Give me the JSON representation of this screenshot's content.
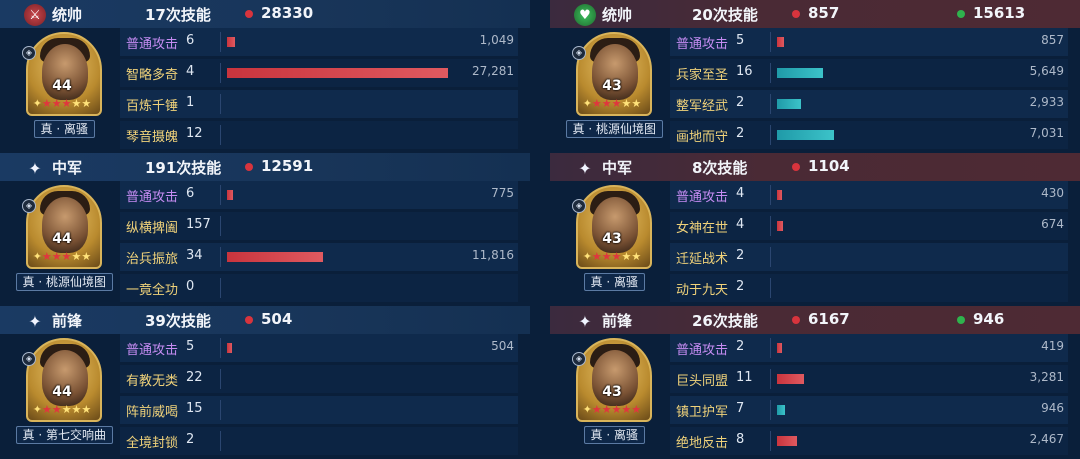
{
  "left": {
    "sections": [
      {
        "role": "统帅",
        "role_icon": "sword-emblem-icon",
        "skill_count": "17次技能",
        "damage": "28330",
        "heal": "",
        "general": {
          "level": "44",
          "stars": 5,
          "red_stars": 3,
          "tag": "真 · 离骚"
        },
        "skills": [
          {
            "name": "普通攻击",
            "count": "6",
            "value": "1,049",
            "share": 0.038,
            "color": "purple"
          },
          {
            "name": "智略多奇",
            "count": "4",
            "value": "27,281",
            "share": 1.0,
            "color": "gold"
          },
          {
            "name": "百炼千锤",
            "count": "1",
            "value": "",
            "share": 0,
            "color": "gold"
          },
          {
            "name": "琴音摄魄",
            "count": "12",
            "value": "",
            "share": 0,
            "color": "gold"
          }
        ]
      },
      {
        "role": "中军",
        "role_icon": "sparkle-icon",
        "skill_count": "191次技能",
        "damage": "12591",
        "heal": "",
        "general": {
          "level": "44",
          "stars": 5,
          "red_stars": 3,
          "tag": "真 · 桃源仙境图"
        },
        "skills": [
          {
            "name": "普通攻击",
            "count": "6",
            "value": "775",
            "share": 0.028,
            "color": "purple"
          },
          {
            "name": "纵横捭阖",
            "count": "157",
            "value": "",
            "share": 0,
            "color": "gold"
          },
          {
            "name": "治兵振旅",
            "count": "34",
            "value": "11,816",
            "share": 0.433,
            "color": "gold"
          },
          {
            "name": "一竟全功",
            "count": "0",
            "value": "",
            "share": 0,
            "color": "gold"
          }
        ]
      },
      {
        "role": "前锋",
        "role_icon": "sparkle-icon",
        "skill_count": "39次技能",
        "damage": "504",
        "heal": "",
        "general": {
          "level": "44",
          "stars": 5,
          "red_stars": 2,
          "tag": "真 · 第七交响曲"
        },
        "skills": [
          {
            "name": "普通攻击",
            "count": "5",
            "value": "504",
            "share": 0.018,
            "color": "purple"
          },
          {
            "name": "有教无类",
            "count": "22",
            "value": "",
            "share": 0,
            "color": "gold"
          },
          {
            "name": "阵前威喝",
            "count": "15",
            "value": "",
            "share": 0,
            "color": "gold"
          },
          {
            "name": "全境封锁",
            "count": "2",
            "value": "",
            "share": 0,
            "color": "gold"
          }
        ]
      }
    ]
  },
  "right": {
    "sections": [
      {
        "role": "统帅",
        "role_icon": "heart-emblem-icon",
        "skill_count": "20次技能",
        "damage": "857",
        "heal": "15613",
        "general": {
          "level": "43",
          "stars": 5,
          "red_stars": 3,
          "tag": "真 · 桃源仙境图"
        },
        "skills": [
          {
            "name": "普通攻击",
            "count": "5",
            "value": "857",
            "share": 0.031,
            "color": "purple",
            "bar": "red"
          },
          {
            "name": "兵家至圣",
            "count": "16",
            "value": "5,649",
            "share": 0.207,
            "color": "gold",
            "bar": "teal"
          },
          {
            "name": "整军经武",
            "count": "2",
            "value": "2,933",
            "share": 0.107,
            "color": "gold",
            "bar": "teal"
          },
          {
            "name": "画地而守",
            "count": "2",
            "value": "7,031",
            "share": 0.258,
            "color": "gold",
            "bar": "teal"
          }
        ]
      },
      {
        "role": "中军",
        "role_icon": "sparkle-icon",
        "skill_count": "8次技能",
        "damage": "1104",
        "heal": "",
        "general": {
          "level": "43",
          "stars": 5,
          "red_stars": 3,
          "tag": "真 · 离骚"
        },
        "skills": [
          {
            "name": "普通攻击",
            "count": "4",
            "value": "430",
            "share": 0.016,
            "color": "purple",
            "bar": "red"
          },
          {
            "name": "女神在世",
            "count": "4",
            "value": "674",
            "share": 0.025,
            "color": "gold",
            "bar": "red"
          },
          {
            "name": "迁延战术",
            "count": "2",
            "value": "",
            "share": 0,
            "color": "gold",
            "bar": "red"
          },
          {
            "name": "动于九天",
            "count": "2",
            "value": "",
            "share": 0,
            "color": "gold",
            "bar": "red"
          }
        ]
      },
      {
        "role": "前锋",
        "role_icon": "sparkle-icon",
        "skill_count": "26次技能",
        "damage": "6167",
        "heal": "946",
        "general": {
          "level": "43",
          "stars": 5,
          "red_stars": 5,
          "tag": "真 · 离骚"
        },
        "skills": [
          {
            "name": "普通攻击",
            "count": "2",
            "value": "419",
            "share": 0.015,
            "color": "purple",
            "bar": "red"
          },
          {
            "name": "巨头同盟",
            "count": "11",
            "value": "3,281",
            "share": 0.12,
            "color": "gold",
            "bar": "red"
          },
          {
            "name": "镇卫护军",
            "count": "7",
            "value": "946",
            "share": 0.035,
            "color": "gold",
            "bar": "teal"
          },
          {
            "name": "绝地反击",
            "count": "8",
            "value": "2,467",
            "share": 0.09,
            "color": "gold",
            "bar": "red"
          }
        ]
      }
    ]
  }
}
